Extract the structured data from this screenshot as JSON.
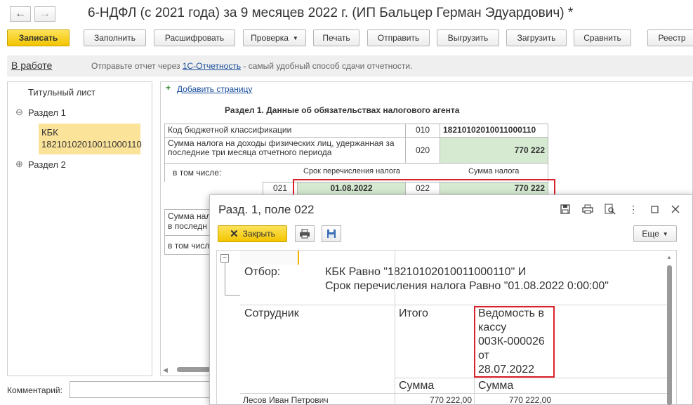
{
  "window": {
    "title": "6-НДФЛ (с 2021 года) за 9 месяцев 2022 г. (ИП Бальцер Герман Эдуардович) *"
  },
  "toolbar": {
    "write": "Записать",
    "fill": "Заполнить",
    "decode": "Расшифровать",
    "check": "Проверка",
    "print": "Печать",
    "send": "Отправить",
    "upload": "Выгрузить",
    "download": "Загрузить",
    "compare": "Сравнить",
    "registry": "Реестр"
  },
  "status": {
    "state": "В работе",
    "hint_prefix": "Отправьте отчет через ",
    "hint_link": "1С-Отчетность",
    "hint_suffix": " - самый удобный способ сдачи отчетности."
  },
  "sidebar": {
    "items": [
      {
        "label": "Титульный лист"
      },
      {
        "label": "Раздел 1"
      },
      {
        "label": "КБК 18210102010011000110"
      },
      {
        "label": "Раздел 2"
      }
    ]
  },
  "form": {
    "add_page": "Добавить страницу",
    "section_title": "Раздел 1. Данные об обязательствах налогового агента",
    "rows": {
      "kbk_label": "Код бюджетной классификации",
      "kbk_code": "010",
      "kbk_value": "18210102010011000110",
      "sum_label": "Сумма налога на доходы физических лиц, удержанная за последние три месяца отчетного периода",
      "sum_code": "020",
      "sum_value": "770 222",
      "including": "в том числе:",
      "col_due": "Срок перечисления налога",
      "col_sum": "Сумма налога",
      "line_code": "021",
      "due_date": "01.08.2022",
      "line_code2": "022",
      "line_sum": "770 222",
      "partial1": "Сумма нал",
      "partial2": "в последн",
      "partial3": "в том числ"
    }
  },
  "dialog": {
    "title": "Разд. 1, поле 022",
    "close": "Закрыть",
    "more": "Еще",
    "filter_label": "Отбор:",
    "filter_line1": "КБК Равно \"18210102010011000110\" И",
    "filter_line2": "Срок перечисления налога Равно \"01.08.2022 0:00:00\"",
    "col_employee": "Сотрудник",
    "col_total": "Итого",
    "vedomost": [
      "Ведомость в",
      "кассу",
      "003К-000026",
      "от",
      "28.07.2022"
    ],
    "sum1": "Сумма",
    "sum2": "Сумма",
    "row_name": "Лесов Иван Петрович",
    "row_total": "770 222,00",
    "row_sum": "770 222,00"
  },
  "comment": {
    "label": "Комментарий:"
  },
  "colors": {
    "accent": "#f3c400",
    "highlight_red": "#d9232b",
    "green_cell": "#d6ead2"
  }
}
